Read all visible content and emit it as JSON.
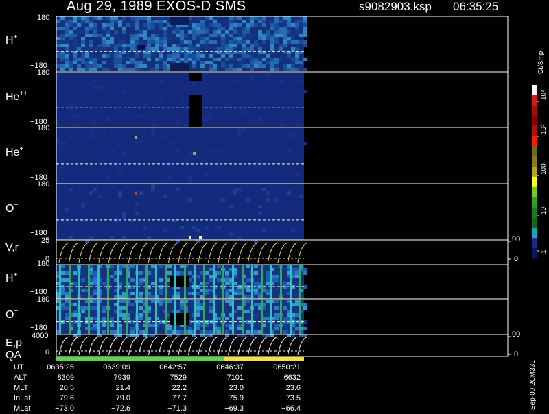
{
  "header": {
    "title": "Aug 29, 1989   EXOS-D SMS",
    "filename": "s9082903.ksp",
    "time": "06:35:25"
  },
  "colorbar": {
    "unit": "Ct/Smp",
    "labels": [
      "10⁴",
      "10³",
      "100",
      "10",
      "1"
    ],
    "colors": [
      "#ffffff",
      "#d81818",
      "#a01010",
      "#8a0000",
      "#b01010",
      "#ff1a00",
      "#6e6a1a",
      "#8a7a1a",
      "#b8a51a",
      "#ffff20",
      "#78c820",
      "#30a020",
      "#1a7a20",
      "#126a18",
      "#10a8b8",
      "#1a2a8a",
      "#0a1660"
    ]
  },
  "panels": [
    {
      "label": "H",
      "sup": "+",
      "ymax": "180",
      "ymin": "−180"
    },
    {
      "label": "He",
      "sup": "++",
      "ymax": "180",
      "ymin": "−180"
    },
    {
      "label": "He",
      "sup": "+",
      "ymax": "180",
      "ymin": "−180"
    },
    {
      "label": "O",
      "sup": "+",
      "ymax": "180",
      "ymin": "−180"
    },
    {
      "label": "V,r",
      "sup": "",
      "ymax": "25",
      "ymin": "0",
      "rmax": "90",
      "rmin": "0"
    },
    {
      "label": "H",
      "sup": "+",
      "ymax": "180",
      "ymin": "−180"
    },
    {
      "label": "O",
      "sup": "+",
      "ymax": "180",
      "ymin": "−180"
    },
    {
      "label": "E,p",
      "sup": "",
      "ymax": "4000",
      "ymin": "0",
      "rmax": "90",
      "rmin": "0"
    }
  ],
  "qa_label": "QA",
  "side_note": "Sep-00 2CM33L",
  "table": {
    "row_labels": [
      "UT",
      "ALT",
      "MLT",
      "InLat",
      "MLat"
    ],
    "columns": [
      [
        "0635:25",
        "8309",
        "20.5",
        "79.6",
        "−73.0"
      ],
      [
        "0639:09",
        "7939",
        "21.4",
        "79.0",
        "−72.6"
      ],
      [
        "0642:57",
        "7529",
        "22.2",
        "77.7",
        "−71.3"
      ],
      [
        "0646:37",
        "7101",
        "23.0",
        "75.9",
        "−69.3"
      ],
      [
        "0650:21",
        "6632",
        "23.6",
        "73.5",
        "−66.4"
      ]
    ]
  },
  "chart_data": {
    "type": "heatmap",
    "title": "Aug 29, 1989   EXOS-D SMS",
    "x_ticks": [
      "0635:25",
      "0639:09",
      "0642:57",
      "0646:37",
      "0650:21"
    ],
    "panels": [
      "H+",
      "He++",
      "He+",
      "O+",
      "V,r",
      "H+",
      "O+",
      "E,p"
    ],
    "colorbar_unit": "Ct/Smp",
    "colorbar_scale": "log",
    "colorbar_range": [
      1,
      10000
    ]
  }
}
